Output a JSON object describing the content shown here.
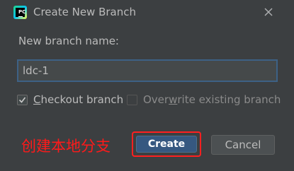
{
  "dialog": {
    "app_icon_text": "PC",
    "title": "Create New Branch"
  },
  "form": {
    "branch_name_label": "New branch name:",
    "branch_name_value": "ldc-1"
  },
  "options": {
    "checkout": {
      "prefix": "",
      "mnemonic": "C",
      "rest": "heckout branch",
      "checked": true
    },
    "overwrite": {
      "prefix": "Over",
      "mnemonic": "w",
      "rest": "rite existing branch",
      "checked": false,
      "enabled": false
    }
  },
  "annotation": {
    "text": "创建本地分支",
    "color": "#ff1a1a"
  },
  "buttons": {
    "create": "Create",
    "cancel": "Cancel"
  },
  "colors": {
    "background": "#3c3f41",
    "primary_button": "#365880",
    "input_focus_border": "#3d6185"
  }
}
